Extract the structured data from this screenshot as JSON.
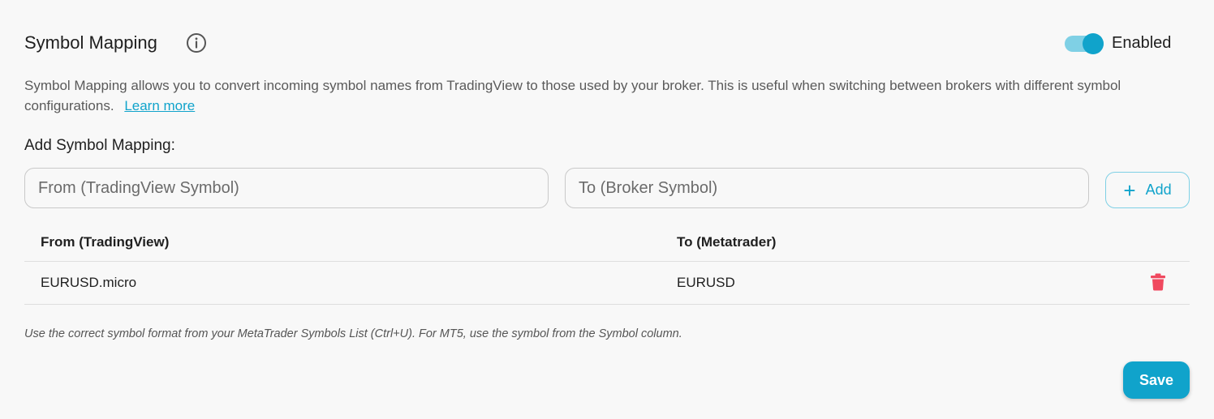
{
  "colors": {
    "accent": "#10a3cb",
    "toggle_track": "#7fd0e5",
    "danger": "#f0495f",
    "info_icon": "#555555"
  },
  "header": {
    "title": "Symbol Mapping",
    "info_icon": "info-circle-icon",
    "toggle_state": "on",
    "toggle_label": "Enabled"
  },
  "description": {
    "text": "Symbol Mapping allows you to convert incoming symbol names from TradingView to those used by your broker. This is useful when switching between brokers with different symbol configurations.",
    "link_text": "Learn more"
  },
  "add_form": {
    "label": "Add Symbol Mapping:",
    "from_placeholder": "From (TradingView Symbol)",
    "from_value": "",
    "to_placeholder": "To (Broker Symbol)",
    "to_value": "",
    "add_icon": "plus-icon",
    "add_label": "Add"
  },
  "table": {
    "columns": [
      "From (TradingView)",
      "To (Metatrader)"
    ],
    "rows": [
      {
        "from": "EURUSD.micro",
        "to": "EURUSD",
        "action_icon": "trash-icon"
      }
    ]
  },
  "hint": "Use the correct symbol format from your MetaTrader Symbols List (Ctrl+U). For MT5, use the symbol from the Symbol column.",
  "save_label": "Save"
}
